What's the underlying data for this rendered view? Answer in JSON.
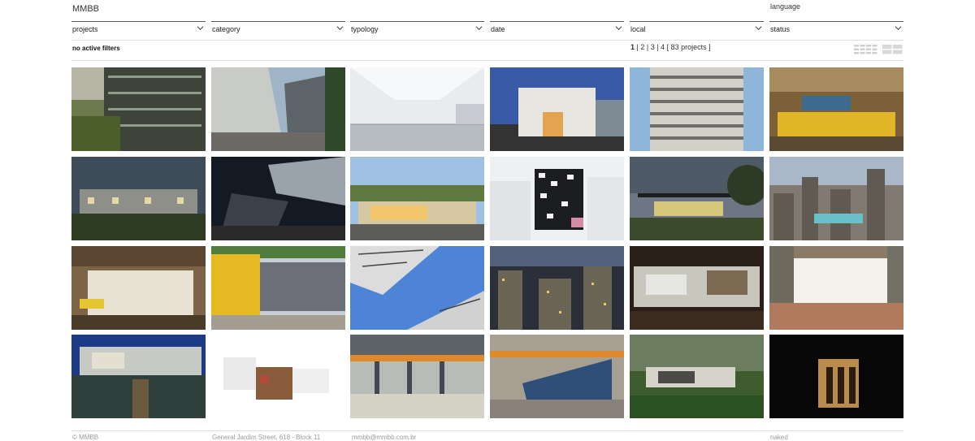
{
  "header": {
    "logo": "MMBB",
    "language": "language"
  },
  "filters": [
    {
      "label": "projects"
    },
    {
      "label": "category"
    },
    {
      "label": "typology"
    },
    {
      "label": "date"
    },
    {
      "label": "local"
    },
    {
      "label": "status"
    }
  ],
  "status_bar": {
    "active_filters": "no active filters",
    "pages": [
      "1",
      "2",
      "3",
      "4"
    ],
    "current_page": "1",
    "separator": " | ",
    "count_label": "[ 83 projects ]"
  },
  "footer": {
    "copyright": "© MMBB",
    "address": "General Jardim Street, 618 - Block 11",
    "email": "mmbb@mmbb.com.br",
    "credit": "naked"
  }
}
